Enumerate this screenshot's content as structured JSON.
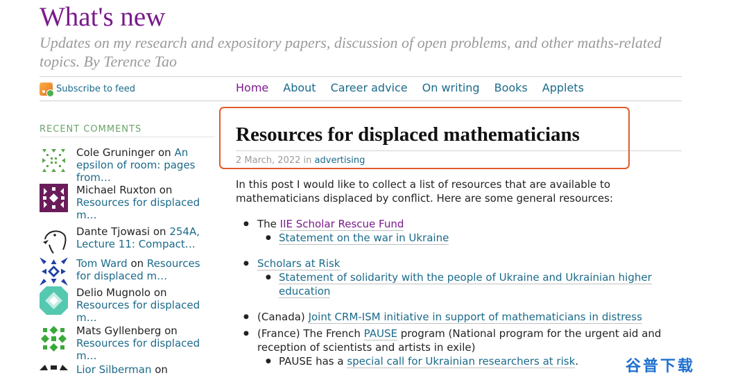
{
  "site": {
    "title": "What's new",
    "tagline": "Updates on my research and expository papers, discussion of open problems, and other maths-related topics. By Terence Tao"
  },
  "feed": {
    "label": "Subscribe to feed",
    "icon": "rss-feed-icon"
  },
  "nav": [
    "Home",
    "About",
    "Career advice",
    "On writing",
    "Books",
    "Applets"
  ],
  "sidebar": {
    "heading": "RECENT COMMENTS",
    "comments": [
      {
        "author": "Cole Gruninger",
        "on": "on",
        "post": "An epsilon of room: pages from…",
        "avatar_color": "#5aa64a",
        "author_link": false
      },
      {
        "author": "Michael Ruxton",
        "on": "on",
        "post": "Resources for displaced m…",
        "avatar_color": "#6a1c5a",
        "author_link": false
      },
      {
        "author": "Dante Tjowasi",
        "on": "on",
        "post": "254A, Lecture 11: Compact…",
        "avatar_color": "#222222",
        "author_link": false
      },
      {
        "author": "Tom Ward",
        "on": "on",
        "post": "Resources for displaced m…",
        "avatar_color": "#1f3fa8",
        "author_link": true
      },
      {
        "author": "Delio Mugnolo",
        "on": "on",
        "post": "Resources for displaced m…",
        "avatar_color": "#55c8b0",
        "author_link": false
      },
      {
        "author": "Mats Gyllenberg",
        "on": "on",
        "post": "Resources for displaced m…",
        "avatar_color": "#3aa83a",
        "author_link": false
      },
      {
        "author": "Lior Silberman",
        "on": "on",
        "post": "",
        "avatar_color": "#222222",
        "author_link": true
      }
    ]
  },
  "post": {
    "title": "Resources for displaced mathematicians",
    "date": "2 March, 2022",
    "in": "in",
    "category": "advertising",
    "intro": "In this post I would like to collect a list of resources that are available to mathematicians displaced by conflict. Here are some general resources:",
    "items": {
      "iie_prefix": "The ",
      "iie_link": "IIE Scholar Rescue Fund",
      "iie_sub": "Statement on the war in Ukraine",
      "sar_link": "Scholars at Risk",
      "sar_sub": "Statement of solidarity with the people of Ukraine and Ukrainian higher education",
      "canada_prefix": "(Canada) ",
      "canada_link": "Joint CRM-ISM initiative in support of mathematicians in distress",
      "france_prefix": "(France) The French ",
      "france_link": "PAUSE",
      "france_suffix": " program (National program for the urgent aid and reception of scientists and artists in exile)",
      "pause_prefix": "PAUSE has a ",
      "pause_link": "special call for Ukrainian researchers at risk",
      "pause_suffix": "."
    }
  },
  "watermark": "谷普下载",
  "colors": {
    "title": "#7a1a8c",
    "link": "#1b6a8a",
    "highlight_border": "#e25a2a",
    "sidebar_heading": "#6aa36a"
  }
}
